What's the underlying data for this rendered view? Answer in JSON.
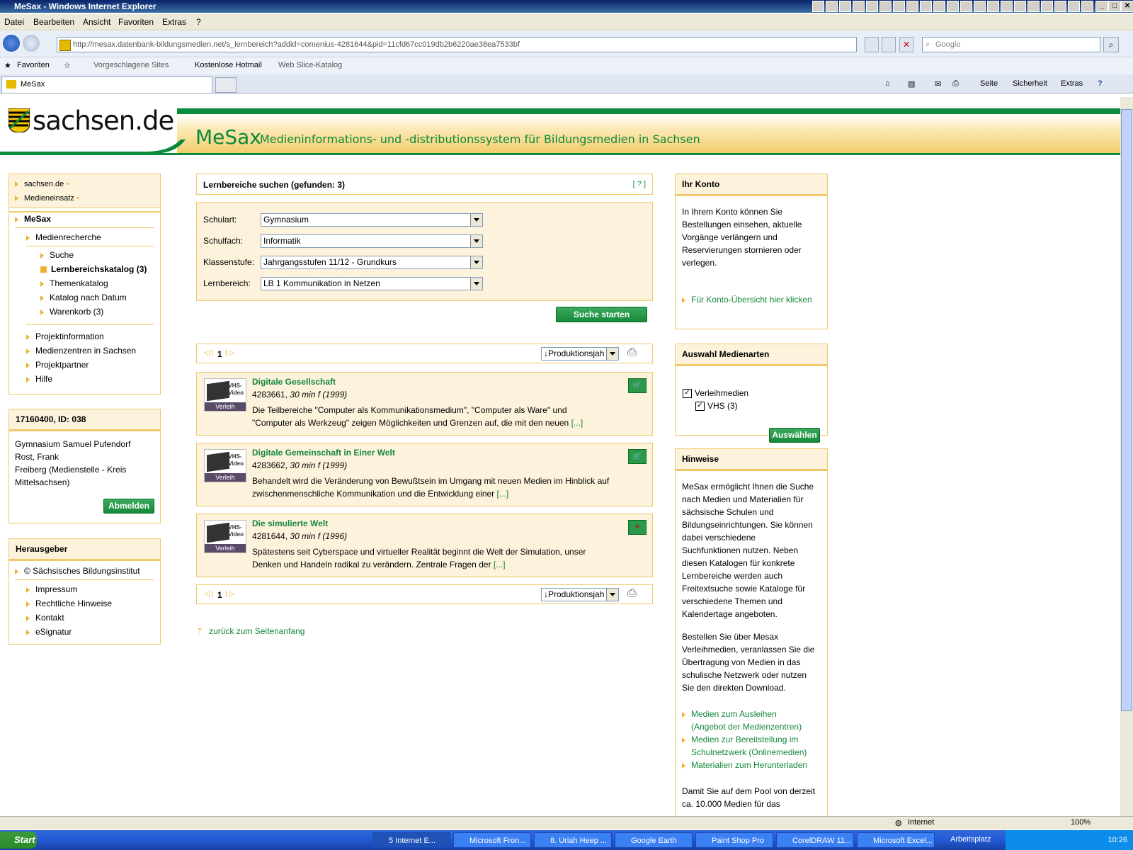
{
  "window": {
    "title": "MeSax - Windows Internet Explorer"
  },
  "menu": [
    "Datei",
    "Bearbeiten",
    "Ansicht",
    "Favoriten",
    "Extras",
    "?"
  ],
  "address": {
    "url": "http://mesax.datenbank-bildungsmedien.net/s_lernbereich?addid=comenius-4281644&pid=11cfd67cc019db2b6220ae38ea7533bf",
    "search_placeholder": "Google"
  },
  "favorites_bar": {
    "favorites": "Favoriten",
    "items": [
      "Vorgeschlagene Sites",
      "Kostenlose Hotmail",
      "Web Slice-Katalog"
    ]
  },
  "tab": {
    "label": "MeSax",
    "commands": [
      "Seite",
      "Sicherheit",
      "Extras"
    ]
  },
  "header": {
    "logo": "sachsen.de",
    "app": "MeSax",
    "subtitle": "Medieninformations- und -distributionssystem für Bildungsmedien in Sachsen"
  },
  "leftnav": {
    "top_links": [
      "sachsen.de",
      "Medieneinsatz"
    ],
    "section": "MeSax",
    "group": "Medienrecherche",
    "sub_items": [
      "Suche",
      "Lernbereichskatalog (3)",
      "Themenkatalog",
      "Katalog nach Datum",
      "Warenkorb (3)"
    ],
    "items": [
      "Projektinformation",
      "Medienzentren in Sachsen",
      "Projektpartner",
      "Hilfe"
    ]
  },
  "user_box": {
    "title": "17160400, ID: 038",
    "lines": [
      "Gymnasium Samuel Pufendorf",
      "Rost, Frank",
      "Freiberg (Medienstelle - Kreis",
      "Mittelsachsen)"
    ],
    "logout": "Abmelden"
  },
  "publisher_box": {
    "title": "Herausgeber",
    "org": "© Sächsisches Bildungsinstitut",
    "links": [
      "Impressum",
      "Rechtliche Hinweise",
      "Kontakt",
      "eSignatur"
    ]
  },
  "search": {
    "title": "Lernbereiche suchen (gefunden: 3)",
    "help": "[ ? ]",
    "fields": [
      {
        "label": "Schulart:",
        "value": "Gymnasium"
      },
      {
        "label": "Schulfach:",
        "value": "Informatik"
      },
      {
        "label": "Klassenstufe:",
        "value": "Jahrgangsstufen 11/12 - Grundkurs"
      },
      {
        "label": "Lernbereich:",
        "value": "LB 1 Kommunikation in Netzen"
      }
    ],
    "submit": "Suche starten"
  },
  "pager": {
    "page": "1",
    "sort": "↓Produktionsjah"
  },
  "results": [
    {
      "title": "Digitale Gesellschaft",
      "id": "4283661,",
      "meta": "30 min f (1999)",
      "desc1": "Die Teilbereiche \"Computer als Kommunikationsmedium\", \"Computer als Ware\" und",
      "desc2": "\"Computer als Werkzeug\" zeigen Möglichkeiten und Grenzen auf, die mit den neuen",
      "more": "[...]",
      "badge": "Verleih",
      "cart": "add"
    },
    {
      "title": "Digitale Gemeinschaft in Einer Welt",
      "id": "4283662,",
      "meta": "30 min f (1999)",
      "desc1": "Behandelt wird die Veränderung von Bewußtsein im Umgang mit neuen Medien im Hinblick auf",
      "desc2": "zwischenmenschliche Kommunikation und die Entwicklung einer",
      "more": "[...]",
      "badge": "Verleih",
      "cart": "add"
    },
    {
      "title": "Die simulierte Welt",
      "id": "4281644,",
      "meta": "30 min f (1996)",
      "desc1": "Spätestens seit Cyberspace und virtueller Realität beginnt die Welt der Simulation, unser",
      "desc2": "Denken und Handeln radikal zu verändern. Zentrale Fragen der",
      "more": "[...]",
      "badge": "Verleih",
      "cart": "remove"
    }
  ],
  "back_to_top": "zurück zum Seitenanfang",
  "account": {
    "title": "Ihr Konto",
    "text": [
      "In Ihrem Konto können Sie",
      "Bestellungen einsehen, aktuelle",
      "Vorgänge verlängern und",
      "Reservierungen stornieren oder",
      "verlegen."
    ],
    "link": "Für Konto-Übersicht hier klicken"
  },
  "media_types": {
    "title": "Auswahl Medienarten",
    "items": [
      "Verleihmedien",
      "VHS (3)"
    ],
    "submit": "Auswählen"
  },
  "hints": {
    "title": "Hinweise",
    "p1": [
      "MeSax ermöglicht Ihnen die Suche",
      "nach Medien und Materialien für",
      "sächsische Schulen und",
      "Bildungseinrichtungen. Sie können",
      "dabei verschiedene",
      "Suchfunktionen nutzen. Neben",
      "diesen Katalogen für konkrete",
      "Lernbereiche werden auch",
      "Freitextsuche sowie Kataloge für",
      "verschiedene Themen und",
      "Kalendertage angeboten."
    ],
    "p2": [
      "Bestellen Sie über Mesax",
      "Verleihmedien, veranlassen Sie die",
      "Übertragung von Medien in das",
      "schulische Netzwerk oder nutzen",
      "Sie den direkten Download."
    ],
    "links": [
      "Medien zum Ausleihen",
      "(Angebot der Medienzentren)",
      "Medien zur Bereitstellung im",
      "Schulnetzwerk (Onlinemedien)",
      "Materialien zum Herunterladen"
    ],
    "p3": [
      "Damit Sie auf dem Pool von derzeit",
      "ca. 10.000 Medien für das"
    ]
  },
  "status": {
    "zone": "Internet",
    "zoom": "100%"
  },
  "taskbar": {
    "start": "Start",
    "tasks": [
      "5 Internet E...",
      "Microsoft Fron...",
      "8. Uriah Heep ...",
      "Google Earth",
      "Paint Shop Pro",
      "CorelDRAW 11...",
      "Microsoft Excel..."
    ],
    "workspace": "Arbeitsplatz",
    "lang": "DE",
    "time": "10:26"
  },
  "colors": {
    "accent_green": "#13873a",
    "box_bg": "#fdf3dc",
    "box_border": "#f0c86a"
  }
}
